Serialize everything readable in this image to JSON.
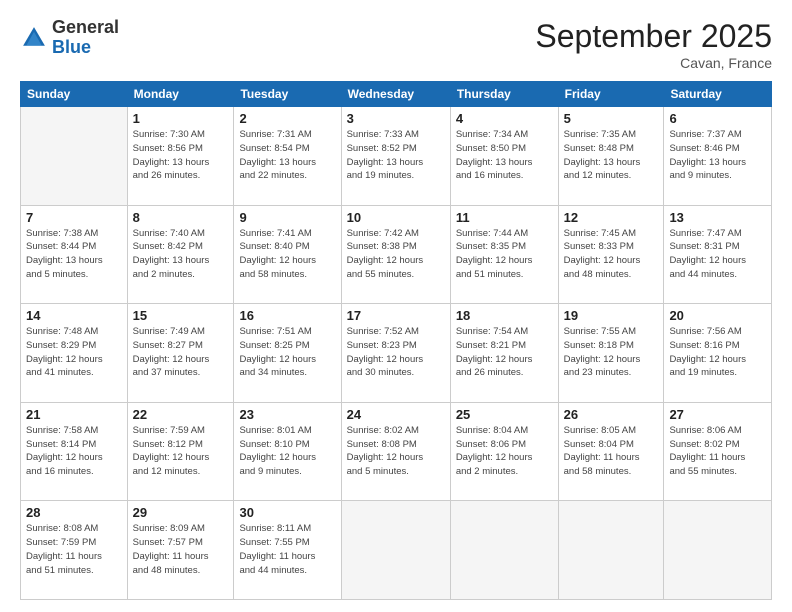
{
  "logo": {
    "general": "General",
    "blue": "Blue"
  },
  "header": {
    "month": "September 2025",
    "location": "Cavan, France"
  },
  "days_of_week": [
    "Sunday",
    "Monday",
    "Tuesday",
    "Wednesday",
    "Thursday",
    "Friday",
    "Saturday"
  ],
  "weeks": [
    [
      {
        "day": "",
        "info": ""
      },
      {
        "day": "1",
        "info": "Sunrise: 7:30 AM\nSunset: 8:56 PM\nDaylight: 13 hours\nand 26 minutes."
      },
      {
        "day": "2",
        "info": "Sunrise: 7:31 AM\nSunset: 8:54 PM\nDaylight: 13 hours\nand 22 minutes."
      },
      {
        "day": "3",
        "info": "Sunrise: 7:33 AM\nSunset: 8:52 PM\nDaylight: 13 hours\nand 19 minutes."
      },
      {
        "day": "4",
        "info": "Sunrise: 7:34 AM\nSunset: 8:50 PM\nDaylight: 13 hours\nand 16 minutes."
      },
      {
        "day": "5",
        "info": "Sunrise: 7:35 AM\nSunset: 8:48 PM\nDaylight: 13 hours\nand 12 minutes."
      },
      {
        "day": "6",
        "info": "Sunrise: 7:37 AM\nSunset: 8:46 PM\nDaylight: 13 hours\nand 9 minutes."
      }
    ],
    [
      {
        "day": "7",
        "info": "Sunrise: 7:38 AM\nSunset: 8:44 PM\nDaylight: 13 hours\nand 5 minutes."
      },
      {
        "day": "8",
        "info": "Sunrise: 7:40 AM\nSunset: 8:42 PM\nDaylight: 13 hours\nand 2 minutes."
      },
      {
        "day": "9",
        "info": "Sunrise: 7:41 AM\nSunset: 8:40 PM\nDaylight: 12 hours\nand 58 minutes."
      },
      {
        "day": "10",
        "info": "Sunrise: 7:42 AM\nSunset: 8:38 PM\nDaylight: 12 hours\nand 55 minutes."
      },
      {
        "day": "11",
        "info": "Sunrise: 7:44 AM\nSunset: 8:35 PM\nDaylight: 12 hours\nand 51 minutes."
      },
      {
        "day": "12",
        "info": "Sunrise: 7:45 AM\nSunset: 8:33 PM\nDaylight: 12 hours\nand 48 minutes."
      },
      {
        "day": "13",
        "info": "Sunrise: 7:47 AM\nSunset: 8:31 PM\nDaylight: 12 hours\nand 44 minutes."
      }
    ],
    [
      {
        "day": "14",
        "info": "Sunrise: 7:48 AM\nSunset: 8:29 PM\nDaylight: 12 hours\nand 41 minutes."
      },
      {
        "day": "15",
        "info": "Sunrise: 7:49 AM\nSunset: 8:27 PM\nDaylight: 12 hours\nand 37 minutes."
      },
      {
        "day": "16",
        "info": "Sunrise: 7:51 AM\nSunset: 8:25 PM\nDaylight: 12 hours\nand 34 minutes."
      },
      {
        "day": "17",
        "info": "Sunrise: 7:52 AM\nSunset: 8:23 PM\nDaylight: 12 hours\nand 30 minutes."
      },
      {
        "day": "18",
        "info": "Sunrise: 7:54 AM\nSunset: 8:21 PM\nDaylight: 12 hours\nand 26 minutes."
      },
      {
        "day": "19",
        "info": "Sunrise: 7:55 AM\nSunset: 8:18 PM\nDaylight: 12 hours\nand 23 minutes."
      },
      {
        "day": "20",
        "info": "Sunrise: 7:56 AM\nSunset: 8:16 PM\nDaylight: 12 hours\nand 19 minutes."
      }
    ],
    [
      {
        "day": "21",
        "info": "Sunrise: 7:58 AM\nSunset: 8:14 PM\nDaylight: 12 hours\nand 16 minutes."
      },
      {
        "day": "22",
        "info": "Sunrise: 7:59 AM\nSunset: 8:12 PM\nDaylight: 12 hours\nand 12 minutes."
      },
      {
        "day": "23",
        "info": "Sunrise: 8:01 AM\nSunset: 8:10 PM\nDaylight: 12 hours\nand 9 minutes."
      },
      {
        "day": "24",
        "info": "Sunrise: 8:02 AM\nSunset: 8:08 PM\nDaylight: 12 hours\nand 5 minutes."
      },
      {
        "day": "25",
        "info": "Sunrise: 8:04 AM\nSunset: 8:06 PM\nDaylight: 12 hours\nand 2 minutes."
      },
      {
        "day": "26",
        "info": "Sunrise: 8:05 AM\nSunset: 8:04 PM\nDaylight: 11 hours\nand 58 minutes."
      },
      {
        "day": "27",
        "info": "Sunrise: 8:06 AM\nSunset: 8:02 PM\nDaylight: 11 hours\nand 55 minutes."
      }
    ],
    [
      {
        "day": "28",
        "info": "Sunrise: 8:08 AM\nSunset: 7:59 PM\nDaylight: 11 hours\nand 51 minutes."
      },
      {
        "day": "29",
        "info": "Sunrise: 8:09 AM\nSunset: 7:57 PM\nDaylight: 11 hours\nand 48 minutes."
      },
      {
        "day": "30",
        "info": "Sunrise: 8:11 AM\nSunset: 7:55 PM\nDaylight: 11 hours\nand 44 minutes."
      },
      {
        "day": "",
        "info": ""
      },
      {
        "day": "",
        "info": ""
      },
      {
        "day": "",
        "info": ""
      },
      {
        "day": "",
        "info": ""
      }
    ]
  ]
}
